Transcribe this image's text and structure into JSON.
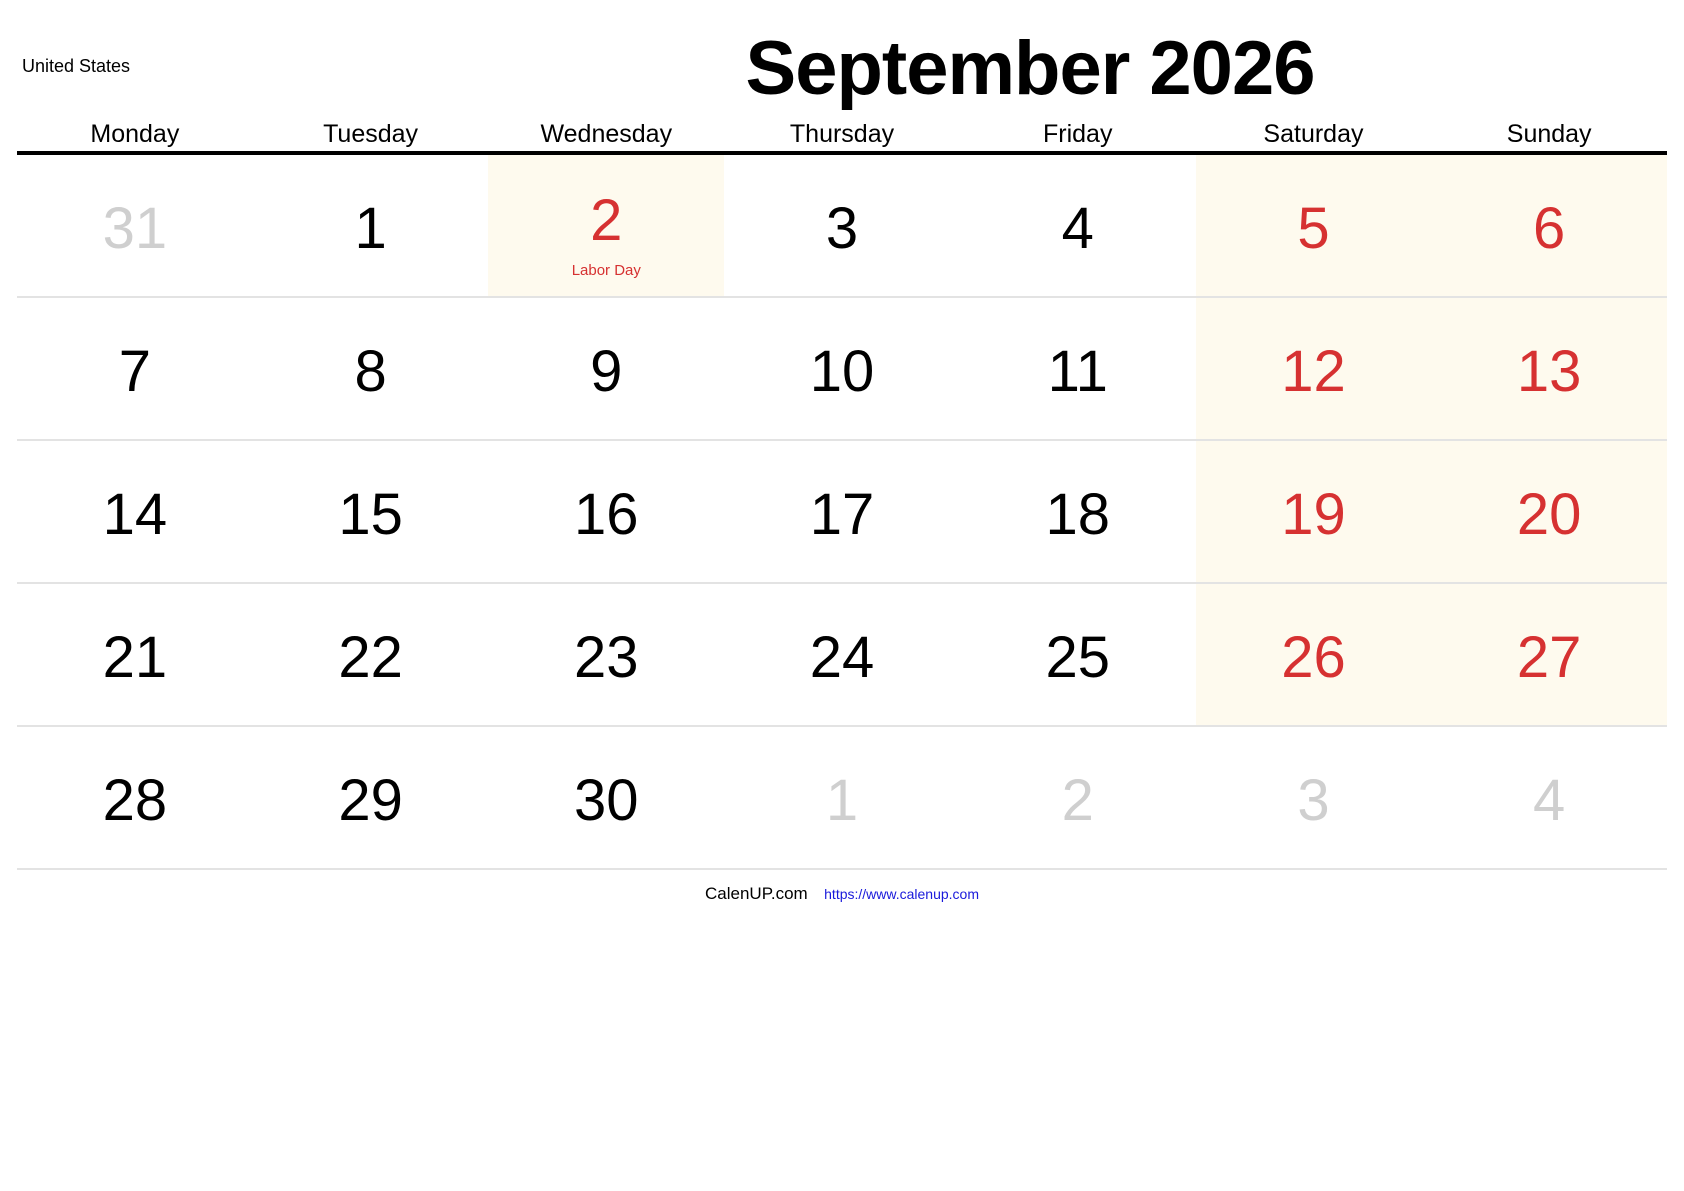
{
  "header": {
    "country": "United States",
    "title": "September 2026"
  },
  "weekdays": [
    "Monday",
    "Tuesday",
    "Wednesday",
    "Thursday",
    "Friday",
    "Saturday",
    "Sunday"
  ],
  "colors": {
    "weekend_text": "#d63131",
    "other_month_text": "#cfcfcf",
    "shade": "#fefaee",
    "link": "#1a1adb"
  },
  "weeks": [
    [
      {
        "day": "31",
        "type": "other"
      },
      {
        "day": "1",
        "type": "normal"
      },
      {
        "day": "2",
        "type": "holiday",
        "holiday": "Labor Day",
        "shaded": true
      },
      {
        "day": "3",
        "type": "normal"
      },
      {
        "day": "4",
        "type": "normal"
      },
      {
        "day": "5",
        "type": "weekend",
        "shaded": true
      },
      {
        "day": "6",
        "type": "weekend",
        "shaded": true
      }
    ],
    [
      {
        "day": "7",
        "type": "normal"
      },
      {
        "day": "8",
        "type": "normal"
      },
      {
        "day": "9",
        "type": "normal"
      },
      {
        "day": "10",
        "type": "normal"
      },
      {
        "day": "11",
        "type": "normal"
      },
      {
        "day": "12",
        "type": "weekend",
        "shaded": true
      },
      {
        "day": "13",
        "type": "weekend",
        "shaded": true
      }
    ],
    [
      {
        "day": "14",
        "type": "normal"
      },
      {
        "day": "15",
        "type": "normal"
      },
      {
        "day": "16",
        "type": "normal"
      },
      {
        "day": "17",
        "type": "normal"
      },
      {
        "day": "18",
        "type": "normal"
      },
      {
        "day": "19",
        "type": "weekend",
        "shaded": true
      },
      {
        "day": "20",
        "type": "weekend",
        "shaded": true
      }
    ],
    [
      {
        "day": "21",
        "type": "normal"
      },
      {
        "day": "22",
        "type": "normal"
      },
      {
        "day": "23",
        "type": "normal"
      },
      {
        "day": "24",
        "type": "normal"
      },
      {
        "day": "25",
        "type": "normal"
      },
      {
        "day": "26",
        "type": "weekend",
        "shaded": true
      },
      {
        "day": "27",
        "type": "weekend",
        "shaded": true
      }
    ],
    [
      {
        "day": "28",
        "type": "normal"
      },
      {
        "day": "29",
        "type": "normal"
      },
      {
        "day": "30",
        "type": "normal"
      },
      {
        "day": "1",
        "type": "other"
      },
      {
        "day": "2",
        "type": "other"
      },
      {
        "day": "3",
        "type": "other"
      },
      {
        "day": "4",
        "type": "other"
      }
    ]
  ],
  "footer": {
    "brand": "CalenUP.com",
    "link": "https://www.calenup.com"
  }
}
